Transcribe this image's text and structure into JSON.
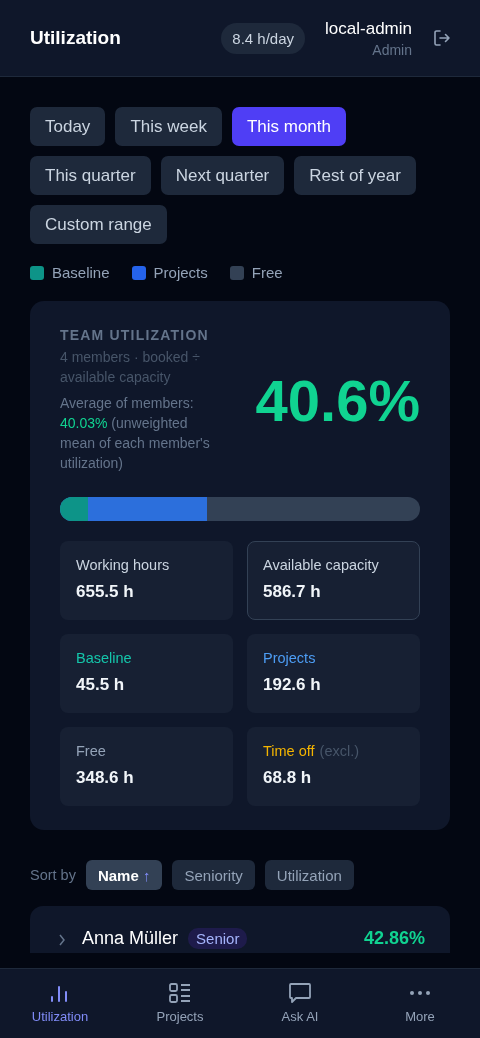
{
  "header": {
    "title": "Utilization",
    "rate": "8.4 h/day",
    "user": "local-admin",
    "role": "Admin"
  },
  "periods": [
    {
      "label": "Today",
      "selected": false
    },
    {
      "label": "This week",
      "selected": false
    },
    {
      "label": "This month",
      "selected": true
    },
    {
      "label": "This quarter",
      "selected": false
    },
    {
      "label": "Next quarter",
      "selected": false
    },
    {
      "label": "Rest of year",
      "selected": false
    },
    {
      "label": "Custom range",
      "selected": false
    }
  ],
  "legend": [
    {
      "label": "Baseline",
      "color": "#0d9488"
    },
    {
      "label": "Projects",
      "color": "#2563eb"
    },
    {
      "label": "Free",
      "color": "#334155"
    }
  ],
  "team": {
    "heading": "TEAM UTILIZATION",
    "subtitle": "4 members · booked ÷ available capacity",
    "average_label": "Average of members:",
    "average_value": "40.03%",
    "average_note": "(unweighted mean of each member's utilization)",
    "value": "40.6%",
    "bar": [
      {
        "level": 0.078,
        "color": "#0d9488"
      },
      {
        "level": 0.408,
        "color": "#2c6fdc"
      }
    ],
    "stats": [
      {
        "label": "Working hours",
        "value": "655.5 h",
        "kind": "neutral",
        "outlined": false
      },
      {
        "label": "Available capacity",
        "value": "586.7 h",
        "kind": "neutral",
        "outlined": true
      },
      {
        "label": "Baseline",
        "value": "45.5 h",
        "kind": "baseline",
        "outlined": false
      },
      {
        "label": "Projects",
        "value": "192.6 h",
        "kind": "projects",
        "outlined": false
      },
      {
        "label": "Free",
        "value": "348.6 h",
        "kind": "free",
        "outlined": false
      },
      {
        "label": "Time off",
        "note": "(excl.)",
        "value": "68.8 h",
        "kind": "timeoff",
        "outlined": false
      }
    ]
  },
  "sort": {
    "label": "Sort by",
    "options": [
      {
        "label": "Name",
        "arrow": "↑",
        "selected": true
      },
      {
        "label": "Seniority",
        "selected": false
      },
      {
        "label": "Utilization",
        "selected": false
      }
    ]
  },
  "members": [
    {
      "name": "Anna Müller",
      "badge": "Senior",
      "value": "42.86%",
      "expanded": false
    }
  ],
  "nav": [
    {
      "label": "Utilization",
      "selected": true
    },
    {
      "label": "Projects",
      "selected": false
    },
    {
      "label": "Ask AI",
      "selected": false
    },
    {
      "label": "More",
      "selected": false
    }
  ]
}
